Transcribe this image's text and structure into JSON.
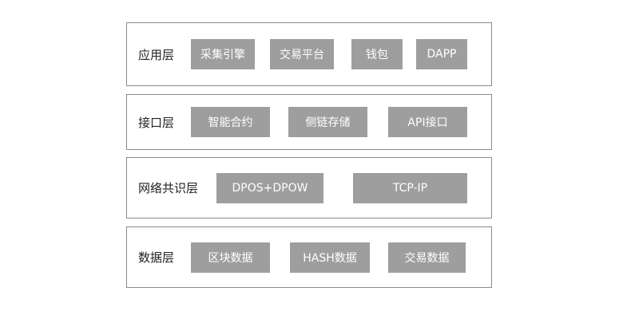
{
  "layers": [
    {
      "label": "应用层",
      "modules": [
        "采集引擎",
        "交易平台",
        "钱包",
        "DAPP"
      ]
    },
    {
      "label": "接口层",
      "modules": [
        "智能合约",
        "侧链存储",
        "API接口"
      ]
    },
    {
      "label": "网络共识层",
      "modules": [
        "DPOS+DPOW",
        "TCP-IP"
      ]
    },
    {
      "label": "数据层",
      "modules": [
        "区块数据",
        "HASH数据",
        "交易数据"
      ]
    }
  ]
}
